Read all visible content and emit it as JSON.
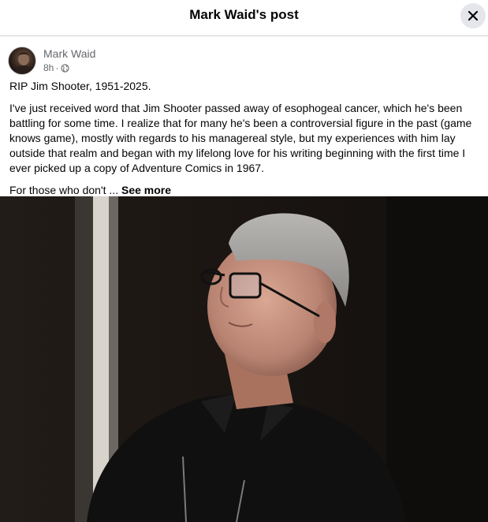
{
  "dialog": {
    "title": "Mark Waid's post",
    "close_icon": "close-icon"
  },
  "post": {
    "author": "Mark Waid",
    "timestamp": "8h",
    "separator": "·",
    "privacy_icon": "globe-icon",
    "paragraphs": [
      "RIP Jim Shooter, 1951-2025.",
      "I've just received word that Jim Shooter passed away of esophogeal cancer, which he's been battling for some time. I realize that for many he's been a controversial figure in the past (game knows game), mostly with regards to his managereal style, but my experiences with him lay outside that realm and began with my lifelong love for his writing beginning with the first time I ever picked up a copy of Adventure Comics in 1967."
    ],
    "truncated_text": "For those who don't ...",
    "see_more_label": "See more"
  },
  "colors": {
    "text": "#050505",
    "secondary_text": "#65676b",
    "divider": "#ced0d4",
    "close_button_bg": "#e4e6eb",
    "photo_background": "#1a1614"
  }
}
